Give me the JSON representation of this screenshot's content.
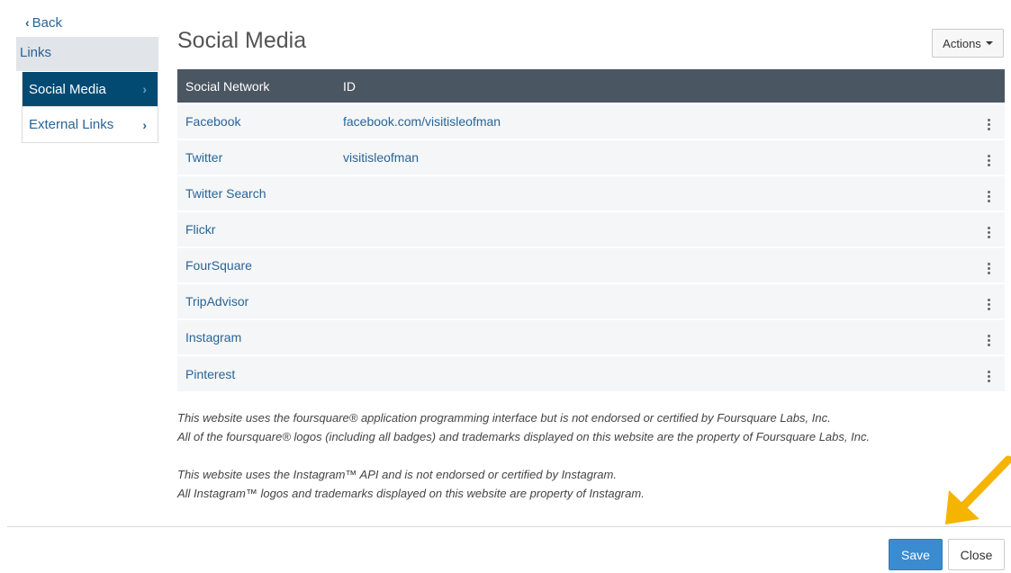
{
  "nav": {
    "back_label": "Back",
    "section_label": "Links",
    "items": [
      {
        "label": "Social Media",
        "active": true
      },
      {
        "label": "External Links",
        "active": false
      }
    ]
  },
  "main": {
    "title": "Social Media",
    "actions_label": "Actions"
  },
  "table": {
    "headers": [
      "Social Network",
      "ID"
    ],
    "rows": [
      {
        "network": "Facebook",
        "id": "facebook.com/visitisleofman"
      },
      {
        "network": "Twitter",
        "id": "visitisleofman"
      },
      {
        "network": "Twitter Search",
        "id": ""
      },
      {
        "network": "Flickr",
        "id": ""
      },
      {
        "network": "FourSquare",
        "id": ""
      },
      {
        "network": "TripAdvisor",
        "id": ""
      },
      {
        "network": "Instagram",
        "id": ""
      },
      {
        "network": "Pinterest",
        "id": ""
      }
    ]
  },
  "disclaimers": {
    "foursquare_1": "This website uses the foursquare® application programming interface but is not endorsed or certified by Foursquare Labs, Inc.",
    "foursquare_2": "All of the foursquare® logos (including all badges) and trademarks displayed on this website are the property of Foursquare Labs, Inc.",
    "instagram_1": "This website uses the Instagram™ API and is not endorsed or certified by Instagram.",
    "instagram_2": "All Instagram™ logos and trademarks displayed on this website are property of Instagram."
  },
  "footer": {
    "save_label": "Save",
    "close_label": "Close"
  },
  "colors": {
    "accent": "#034a73",
    "table_header": "#4b5663",
    "primary_button": "#3a8bd0",
    "link": "#2a6496",
    "annotation": "#f5b400"
  },
  "icons": {
    "back": "chevron-left-icon",
    "nav_item": "chevron-right-icon",
    "actions": "caret-down-icon",
    "row_menu": "kebab-menu-icon",
    "annotation": "arrow-annotation-icon"
  }
}
